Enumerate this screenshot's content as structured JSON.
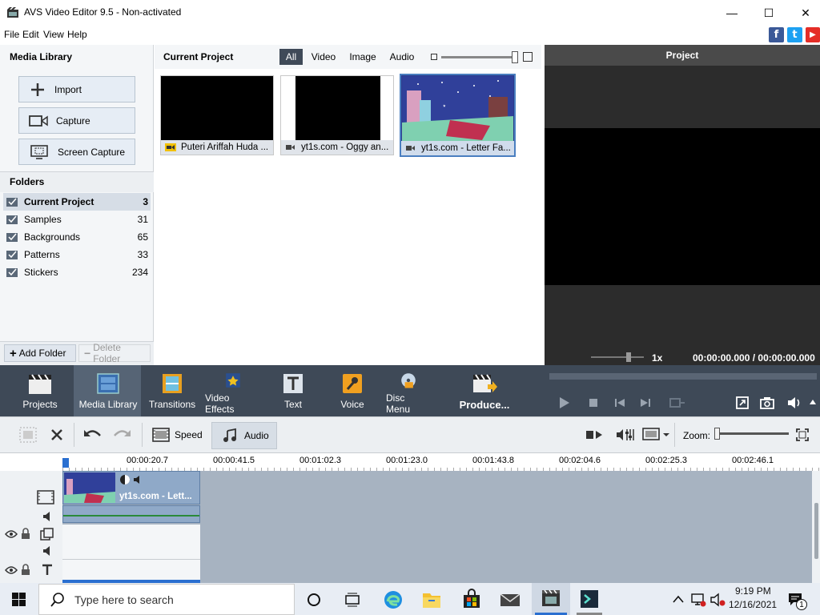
{
  "window": {
    "title": "AVS Video Editor 9.5 - Non-activated",
    "minimize": "—",
    "maximize": "☐",
    "close": "✕"
  },
  "menu": [
    "File",
    "Edit",
    "View",
    "Help"
  ],
  "social": {
    "facebook": "f",
    "twitter": "t",
    "youtube": "▶"
  },
  "media_library": {
    "title": "Media Library",
    "buttons": [
      "Import",
      "Capture",
      "Screen Capture"
    ],
    "folders_title": "Folders",
    "folders": [
      {
        "name": "Current Project",
        "count": "3",
        "selected": true
      },
      {
        "name": "Samples",
        "count": "31"
      },
      {
        "name": "Backgrounds",
        "count": "65"
      },
      {
        "name": "Patterns",
        "count": "33"
      },
      {
        "name": "Stickers",
        "count": "234"
      }
    ],
    "add_folder": "Add Folder",
    "delete_folder": "Delete Folder"
  },
  "project_panel": {
    "title": "Current Project",
    "filters": [
      "All",
      "Video",
      "Image",
      "Audio"
    ],
    "active_filter": "All",
    "items": [
      {
        "caption": "Puteri Ariffah Huda ...",
        "kind": "video"
      },
      {
        "caption": "yt1s.com - Oggy an...",
        "kind": "video"
      },
      {
        "caption": "yt1s.com - Letter Fa...",
        "kind": "video",
        "selected": true
      }
    ]
  },
  "preview": {
    "title": "Project",
    "speed": "1x",
    "time": "00:00:00.000 / 00:00:00.000"
  },
  "main_toolbar": {
    "tools": [
      "Projects",
      "Media Library",
      "Transitions",
      "Video Effects",
      "Text",
      "Voice",
      "Disc Menu"
    ],
    "active_tool": "Media Library",
    "produce": "Produce..."
  },
  "timeline_toolbar": {
    "speed": "Speed",
    "audio": "Audio",
    "zoom_label": "Zoom:"
  },
  "ruler": [
    "00:00:20.7",
    "00:00:41.5",
    "00:01:02.3",
    "00:01:23.0",
    "00:01:43.8",
    "00:02:04.6",
    "00:02:25.3",
    "00:02:46.1"
  ],
  "timeline_clip": {
    "caption": "yt1s.com - Lett..."
  },
  "taskbar": {
    "search_placeholder": "Type here to search",
    "time": "9:19 PM",
    "date": "12/16/2021",
    "notifications": "1"
  }
}
